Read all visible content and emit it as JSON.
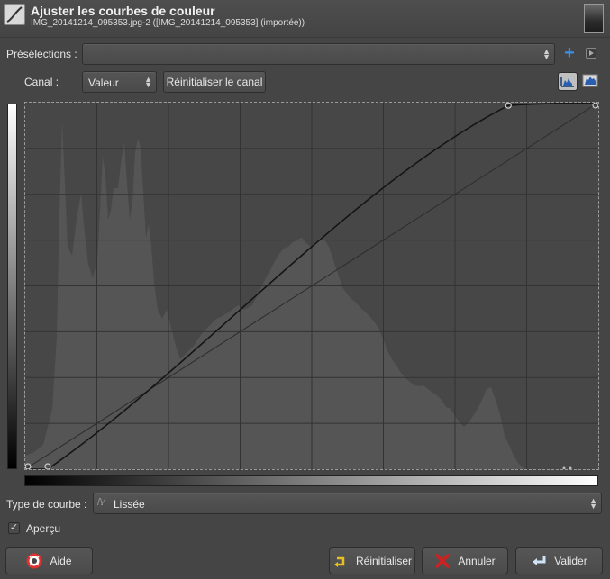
{
  "header": {
    "title": "Ajuster les courbes de couleur",
    "subtitle": "IMG_20141214_095353.jpg-2 ([IMG_20141214_095353] (importée))"
  },
  "presets": {
    "label": "Présélections :",
    "value": ""
  },
  "channel": {
    "label": "Canal :",
    "value": "Valeur",
    "reset_label": "Réinitialiser le canal"
  },
  "curve_type": {
    "label": "Type de courbe :",
    "value": "Lissée"
  },
  "preview": {
    "label": "Aperçu",
    "checked": true
  },
  "buttons": {
    "help": "Aide",
    "reset": "Réinitialiser",
    "cancel": "Annuler",
    "ok": "Valider"
  },
  "colors": {
    "accent_blue": "#3a8fe8",
    "help_red": "#e03030",
    "reset_yellow": "#e8c020",
    "cancel_red": "#d02020"
  },
  "curve": {
    "control_points": [
      [
        0,
        0
      ],
      [
        10,
        0
      ],
      [
        215,
        253
      ],
      [
        255,
        255
      ]
    ],
    "domain": [
      0,
      255
    ]
  }
}
